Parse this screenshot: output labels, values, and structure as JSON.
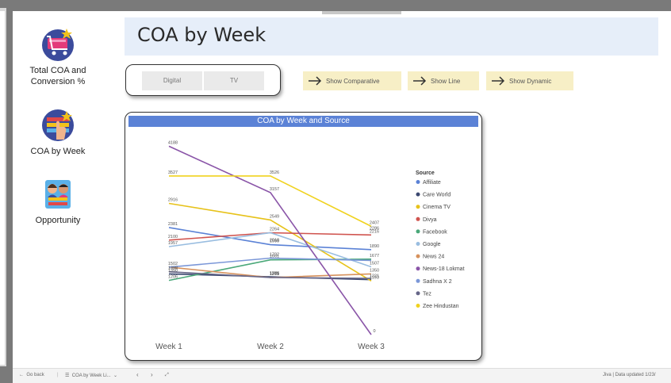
{
  "nav": {
    "items": [
      {
        "label": "Total COA and Conversion %",
        "icon": "shopping-cart-icon"
      },
      {
        "label": "COA by Week",
        "icon": "calendar-hand-icon"
      },
      {
        "label": "Opportunity",
        "icon": "people-icon"
      }
    ]
  },
  "page": {
    "title": "COA by Week"
  },
  "slicer": {
    "options": [
      "Digital",
      "TV"
    ]
  },
  "actions": [
    {
      "label": "Show Comparative",
      "icon": "arrow-right-icon"
    },
    {
      "label": "Show Line",
      "icon": "arrow-right-icon"
    },
    {
      "label": "Show Dynamic",
      "icon": "arrow-right-icon"
    }
  ],
  "chart_data": {
    "type": "line",
    "title": "COA by Week and Source",
    "categories": [
      "Week 1",
      "Week 2",
      "Week 3"
    ],
    "legend_title": "Source",
    "legend_position": "right",
    "grid": false,
    "ylim": [
      0,
      4300
    ],
    "series": [
      {
        "name": "Affiliate",
        "color": "#5b82d6",
        "values": [
          2381,
          1999,
          1890
        ]
      },
      {
        "name": "Care World",
        "color": "#3b4870",
        "values": [
          1350,
          1286,
          1221
        ]
      },
      {
        "name": "Cinema TV",
        "color": "#e7c21a",
        "values": [
          2916,
          2549,
          1193
        ]
      },
      {
        "name": "Divya",
        "color": "#d0544f",
        "values": [
          2100,
          2264,
          2216
        ]
      },
      {
        "name": "Facebook",
        "color": "#4aa879",
        "values": [
          1206,
          1661,
          1677
        ]
      },
      {
        "name": "Google",
        "color": "#99bde0",
        "values": [
          1957,
          2264,
          1507
        ]
      },
      {
        "name": "News 24",
        "color": "#d6915c",
        "values": [
          1502,
          1269,
          1350
        ]
      },
      {
        "name": "News-18 Lokmat",
        "color": "#8a55a8",
        "values": [
          4188,
          3157,
          0
        ]
      },
      {
        "name": "Sadhna X 2",
        "color": "#7b97d8",
        "values": [
          1500,
          1700,
          1650
        ]
      },
      {
        "name": "Tez",
        "color": "#666688",
        "values": [
          1398,
          1271,
          1250
        ]
      },
      {
        "name": "Zee Hindustan",
        "color": "#f0d21e",
        "values": [
          3527,
          3526,
          2407
        ]
      }
    ],
    "point_labels": {
      "Week 1": [
        "4188",
        "3527",
        "2916",
        "2381",
        "2100",
        "1957",
        "1502",
        "1398",
        "1350",
        "1206"
      ],
      "Week 2": [
        "3526",
        "3157",
        "2549",
        "2264",
        "1999",
        "2018",
        "1702",
        "1661",
        "1269",
        "1271",
        "1286"
      ],
      "Week 3": [
        "2407",
        "2216",
        "2286",
        "1890",
        "1677",
        "1507",
        "1350",
        "1193",
        "1221",
        "0"
      ]
    }
  },
  "statusbar": {
    "back": "Go back",
    "page": "COA by Week Li...",
    "right": "Jiva  |  Data updated 1/23/"
  }
}
